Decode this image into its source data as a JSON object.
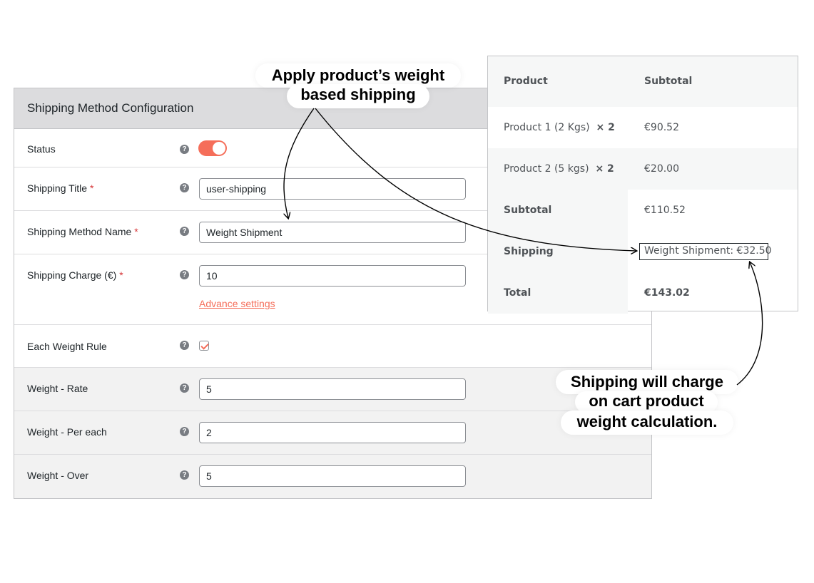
{
  "config": {
    "header": "Shipping Method Configuration",
    "help_glyph": "?",
    "required_mark": "*",
    "rows": {
      "status": {
        "label": "Status",
        "enabled": true
      },
      "title": {
        "label": "Shipping Title",
        "value": "user-shipping"
      },
      "method_name": {
        "label": "Shipping Method Name",
        "value": "Weight Shipment"
      },
      "charge": {
        "label": "Shipping Charge (€)",
        "value": "10",
        "advance_link": "Advance settings"
      },
      "each_weight": {
        "label": "Each Weight Rule",
        "checked": true
      },
      "rate": {
        "label": "Weight - Rate",
        "value": "5"
      },
      "per_each": {
        "label": "Weight - Per each",
        "value": "2"
      },
      "over": {
        "label": "Weight - Over",
        "value": "5"
      }
    }
  },
  "cart": {
    "head": {
      "product": "Product",
      "subtotal": "Subtotal"
    },
    "items": [
      {
        "name": "Product 1 (2 Kgs)",
        "qty": "× 2",
        "amount": "€90.52"
      },
      {
        "name": "Product 2 (5 kgs)",
        "qty": "× 2",
        "amount": "€20.00"
      }
    ],
    "subtotal": {
      "label": "Subtotal",
      "value": "€110.52"
    },
    "shipping": {
      "label": "Shipping",
      "value": "Weight Shipment: €32.50"
    },
    "total": {
      "label": "Total",
      "value": "€143.02"
    }
  },
  "callouts": {
    "top_line1": "Apply product’s weight",
    "top_line2": "based shipping",
    "bottom_line1": "Shipping will charge",
    "bottom_line2": "on cart product",
    "bottom_line3": "weight calculation."
  },
  "colors": {
    "accent": "#f56e5a",
    "header_bg": "#dcdcde",
    "row_grey": "#f2f2f2",
    "cart_grey": "#f6f7f7"
  }
}
